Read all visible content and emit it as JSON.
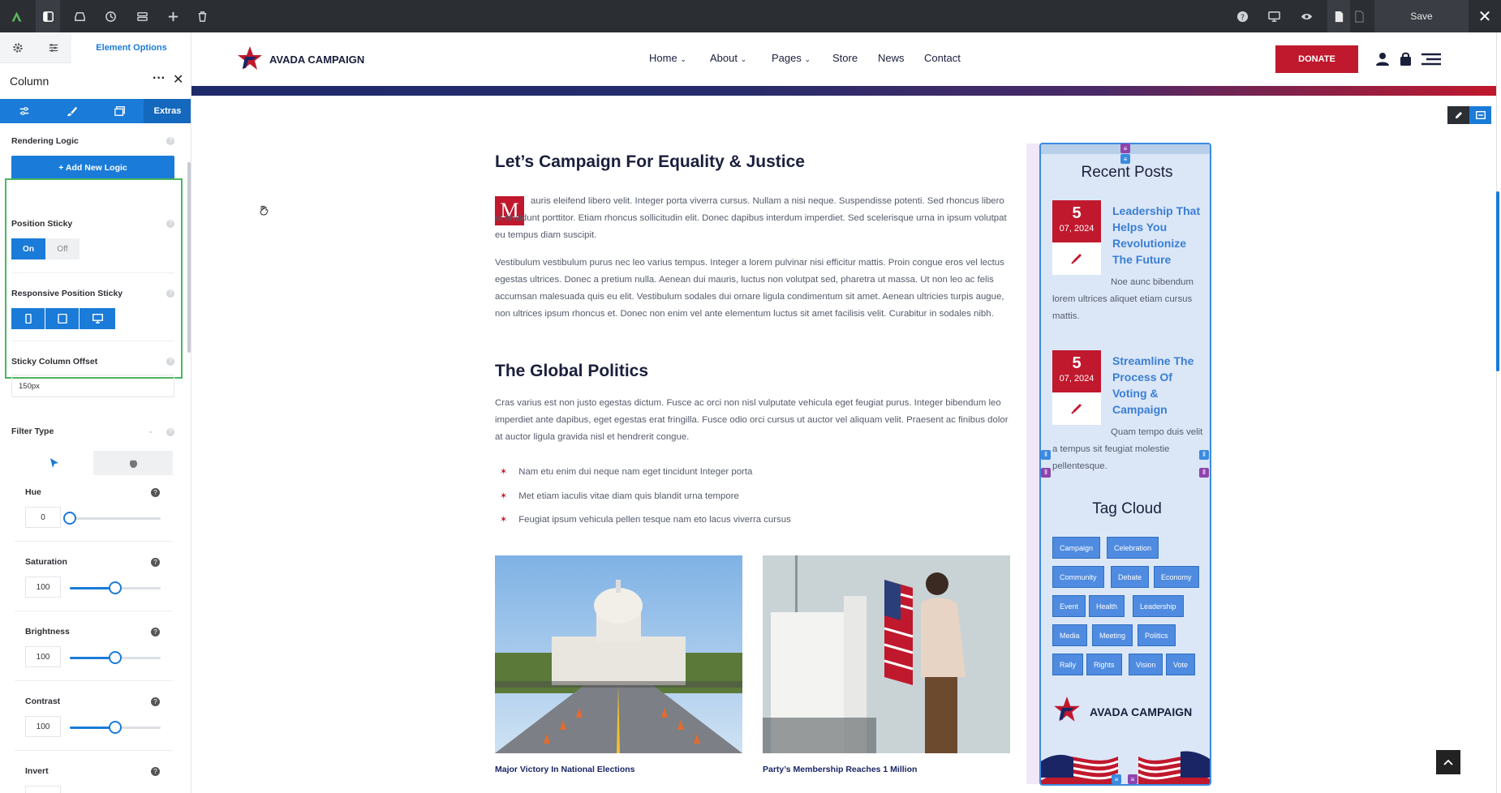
{
  "toolbar": {
    "save_label": "Save",
    "close_label": "✕"
  },
  "sidebar": {
    "top_tab_label": "Element Options",
    "title": "Column",
    "more_label": "···",
    "close_label": "✕",
    "extras_tab_label": "Extras",
    "rendering_logic_label": "Rendering Logic",
    "add_logic_label": "+ Add New Logic",
    "position_sticky_label": "Position Sticky",
    "sticky_on": "On",
    "sticky_off": "Off",
    "responsive_sticky_label": "Responsive Position Sticky",
    "sticky_offset_label": "Sticky Column Offset",
    "sticky_offset_value": "150px",
    "filter_type_label": "Filter Type",
    "filters": [
      {
        "label": "Hue",
        "value": "0",
        "level": 0
      },
      {
        "label": "Saturation",
        "value": "100",
        "level": 0.5
      },
      {
        "label": "Brightness",
        "value": "100",
        "level": 0.5
      },
      {
        "label": "Contrast",
        "value": "100",
        "level": 0.5
      },
      {
        "label": "Invert",
        "value": "",
        "level": 0
      }
    ]
  },
  "site": {
    "logo_text": "AVADA CAMPAIGN",
    "nav": [
      "Home",
      "About",
      "Pages",
      "Store",
      "News",
      "Contact"
    ],
    "donate_label": "DONATE",
    "colors": {
      "brand_red": "#c0182d",
      "brand_navy": "#1a1f3c",
      "accent_blue": "#1a7bd8"
    }
  },
  "article": {
    "heading1": "Let’s Campaign For Equality & Justice",
    "dropcap": "M",
    "para1": "auris eleifend libero velit. Integer porta viverra cursus. Nullam a nisi neque. Suspendisse potenti. Sed rhoncus libero ut tincidunt porttitor. Etiam rhoncus sollicitudin elit. Donec dapibus interdum imperdiet. Sed scelerisque urna in ipsum volutpat eu tempus diam suscipit.",
    "para2": "Vestibulum vestibulum purus nec leo varius tempus. Integer a lorem pulvinar nisi efficitur mattis. Proin congue eros vel lectus egestas ultrices. Donec a pretium nulla. Aenean dui mauris, luctus non volutpat sed, pharetra ut massa. Ut non leo ac felis accumsan malesuada quis eu elit. Vestibulum sodales dui ornare ligula condimentum sit amet. Aenean ultricies turpis augue, non ultrices ipsum rhoncus et. Donec non enim vel ante elementum luctus sit amet facilisis velit. Curabitur in sodales nibh.",
    "heading2": "The Global Politics",
    "para3": "Cras varius est non justo egestas dictum. Fusce ac orci non nisl vulputate vehicula eget feugiat purus. Integer bibendum leo imperdiet ante dapibus, eget egestas erat fringilla. Fusce odio orci cursus ut auctor vel aliquam velit. Praesent ac finibus dolor at auctor ligula gravida nisl et hendrerit congue.",
    "bullets": [
      "Nam etu enim dui neque nam eget tincidunt Integer porta",
      "Met etiam iaculis vitae diam quis blandit urna tempore",
      "Feugiat ipsum vehicula pellen tesque nam eto lacus viverra cursus"
    ],
    "captions": [
      "Major Victory In National Elections",
      "Party’s Membership Reaches 1 Million"
    ]
  },
  "widget": {
    "recent_title": "Recent Posts",
    "posts": [
      {
        "day": "5",
        "month_year": "07, 2024",
        "title": "Leadership That Helps You Revolutionize The Future",
        "excerpt": "Noe aunc bibendum lorem ultrices aliquet etiam cursus mattis."
      },
      {
        "day": "5",
        "month_year": "07, 2024",
        "title": "Streamline The Process Of Voting & Campaign",
        "excerpt": "Quam tempo duis velit a tempus sit feugiat molestie pellentesque."
      }
    ],
    "tag_title": "Tag Cloud",
    "tags": [
      "Campaign",
      "Celebration",
      "Community",
      "Debate",
      "Economy",
      "Event",
      "Health",
      "Leadership",
      "Media",
      "Meeting",
      "Politics",
      "Rally",
      "Rights",
      "Vision",
      "Vote"
    ],
    "logo_text": "AVADA CAMPAIGN"
  }
}
